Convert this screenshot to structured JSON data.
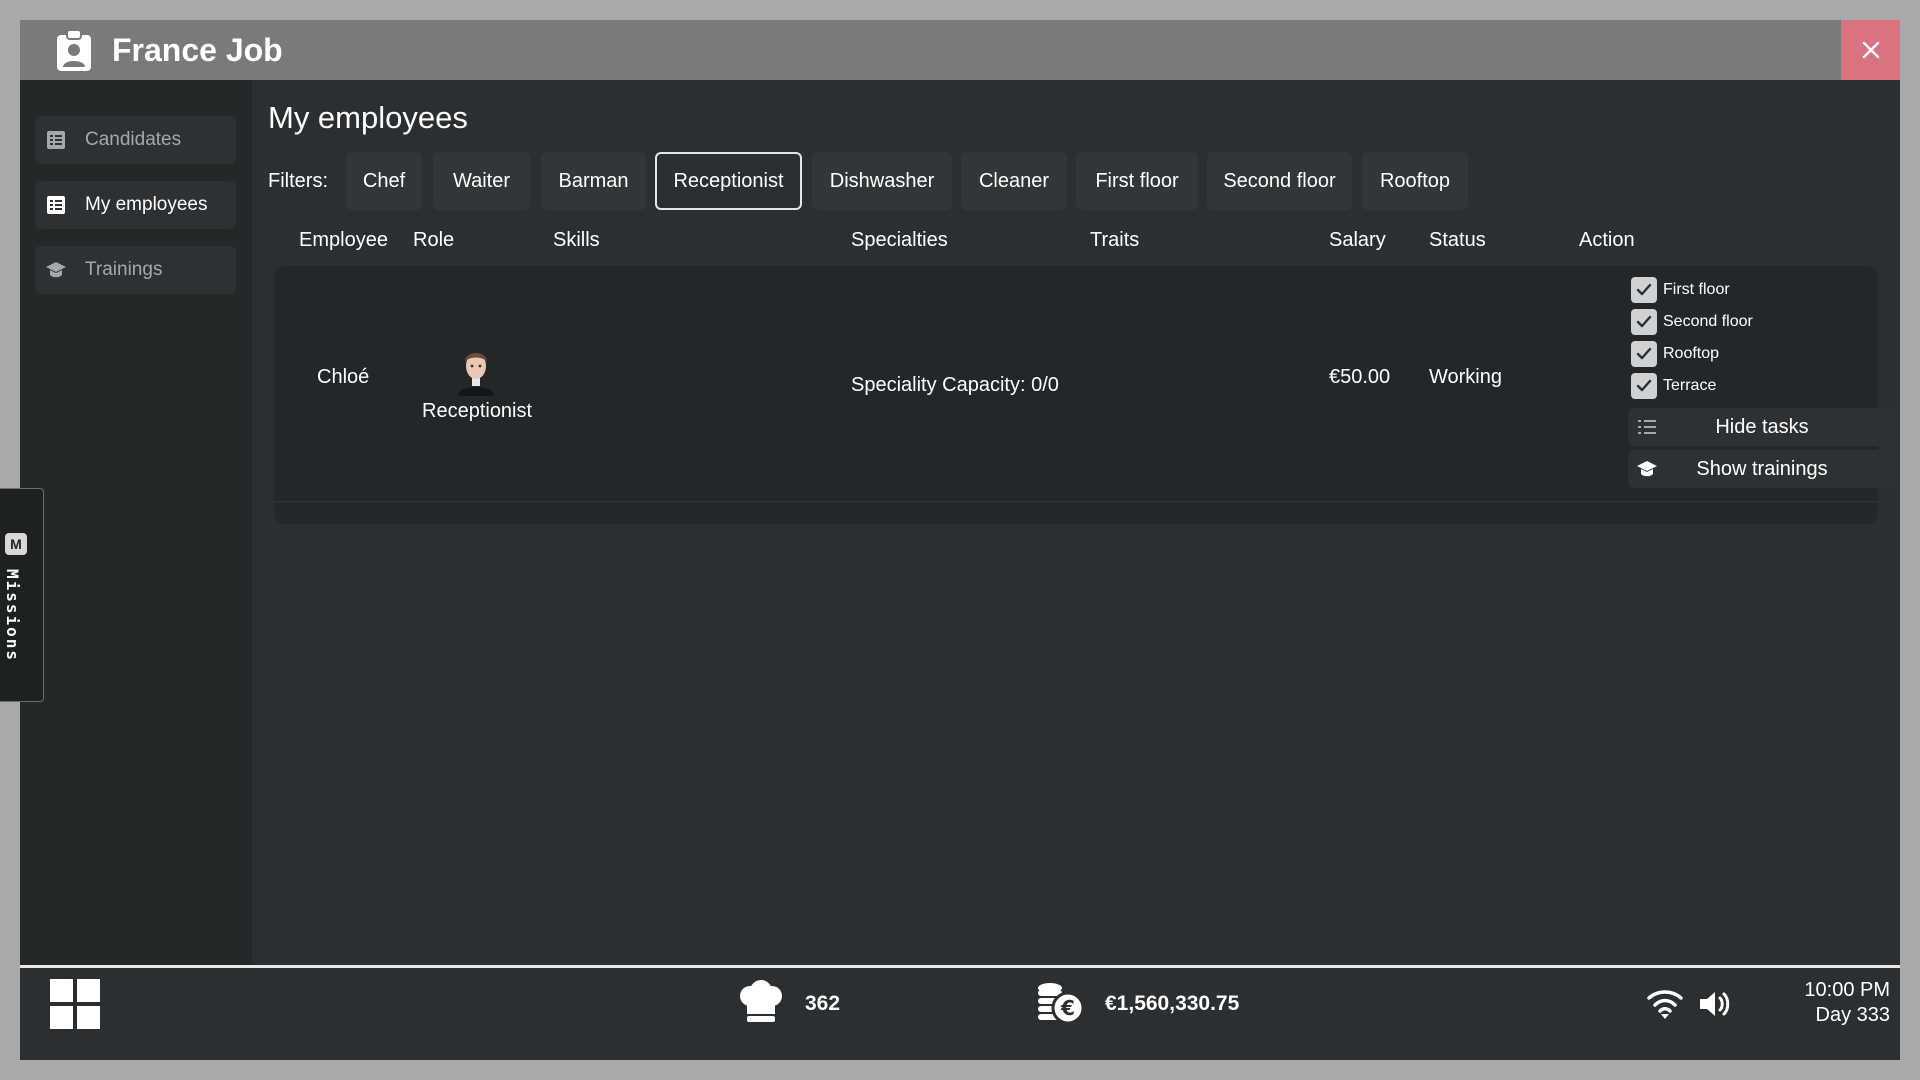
{
  "window": {
    "title": "France Job",
    "app_icon": "clipboard-person-icon",
    "close_icon": "close-icon"
  },
  "sidebar": {
    "items": [
      {
        "label": "Candidates",
        "icon": "table-icon",
        "active": false
      },
      {
        "label": "My employees",
        "icon": "table-icon",
        "active": true
      },
      {
        "label": "Trainings",
        "icon": "graduation-cap-icon",
        "active": false
      }
    ]
  },
  "main": {
    "title": "My employees",
    "filters_label": "Filters:",
    "filters": [
      {
        "label": "Chef",
        "selected": false
      },
      {
        "label": "Waiter",
        "selected": false
      },
      {
        "label": "Barman",
        "selected": false
      },
      {
        "label": "Receptionist",
        "selected": true
      },
      {
        "label": "Dishwasher",
        "selected": false
      },
      {
        "label": "Cleaner",
        "selected": false
      },
      {
        "label": "First floor",
        "selected": false
      },
      {
        "label": "Second floor",
        "selected": false
      },
      {
        "label": "Rooftop",
        "selected": false
      }
    ],
    "columns": [
      "Employee",
      "Role",
      "Skills",
      "Specialties",
      "Traits",
      "Salary",
      "Status",
      "Action"
    ],
    "employees": [
      {
        "name": "Chloé",
        "role": "Receptionist",
        "avatar": "receptionist-avatar",
        "skills": "",
        "specialties": "Speciality Capacity: 0/0",
        "traits": "",
        "salary": "€50.00",
        "status": "Working",
        "floors": [
          {
            "label": "First floor",
            "checked": true
          },
          {
            "label": "Second floor",
            "checked": true
          },
          {
            "label": "Rooftop",
            "checked": true
          },
          {
            "label": "Terrace",
            "checked": true
          }
        ],
        "hide_tasks_label": "Hide tasks",
        "show_trainings_label": "Show trainings"
      }
    ]
  },
  "missions_tab": {
    "key": "M",
    "label": "Missions"
  },
  "taskbar": {
    "start_icon": "windows-grid-icon",
    "meals_icon": "chef-hat-icon",
    "meals_count": "362",
    "money_icon": "coins-euro-icon",
    "money": "€1,560,330.75",
    "wifi_icon": "wifi-icon",
    "volume_icon": "speaker-icon",
    "time": "10:00 PM",
    "day": "Day 333"
  },
  "colors": {
    "titlebar": "#7a7a7a",
    "close_button": "#d9737f",
    "background": "#2c2f31",
    "sidebar": "#252829"
  }
}
